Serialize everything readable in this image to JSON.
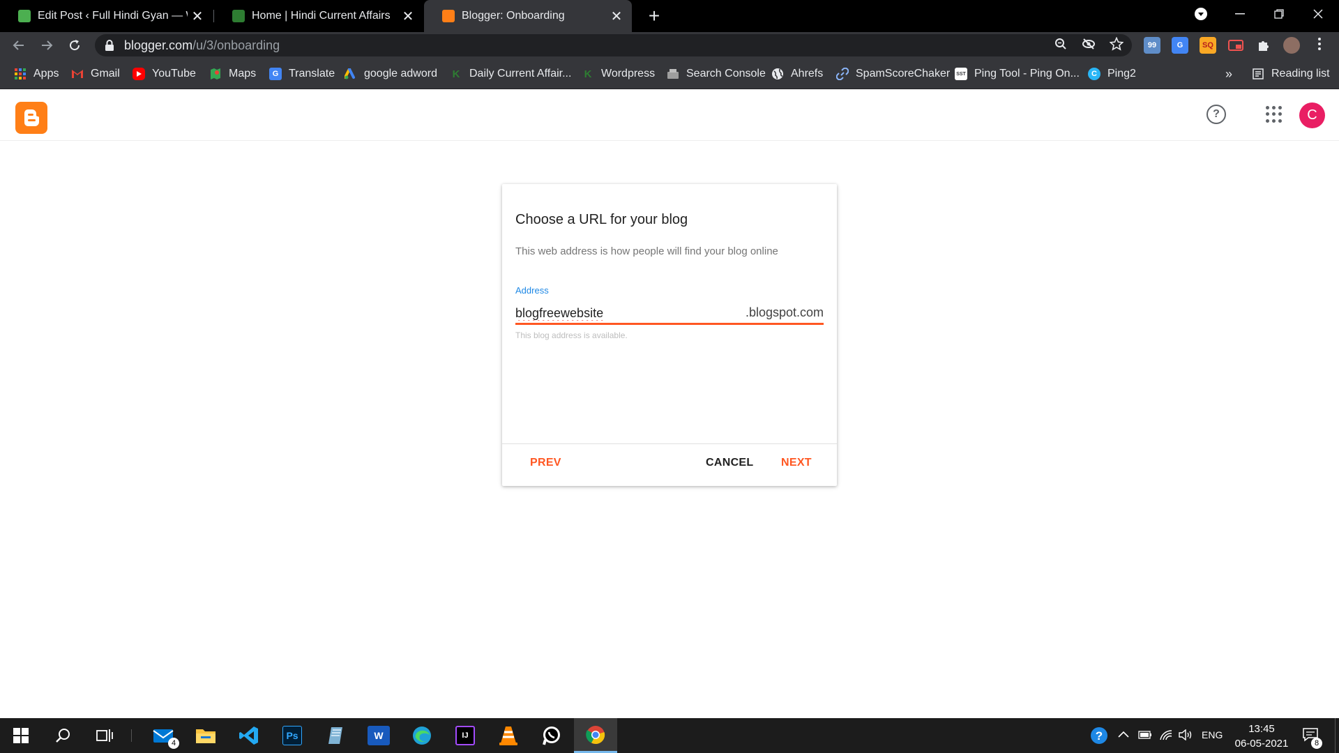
{
  "browser": {
    "tabs": [
      {
        "title": "Edit Post ‹ Full Hindi Gyan — Wo",
        "favicon": "wordpress-favicon",
        "active": false
      },
      {
        "title": "Home | Hindi Current Affairs",
        "favicon": "hindi-current-affairs-favicon",
        "active": false
      },
      {
        "title": "Blogger: Onboarding",
        "favicon": "blogger-favicon",
        "active": true
      }
    ],
    "close_glyph": "✕",
    "newtab_glyph": "+",
    "url_host": "blogger.com",
    "url_path": "/u/3/onboarding",
    "bookmarks": [
      {
        "label": "Apps",
        "icon": "apps-grid-icon",
        "color": "#4285f4"
      },
      {
        "label": "Gmail",
        "icon": "gmail-icon",
        "color": "#ea4335"
      },
      {
        "label": "YouTube",
        "icon": "youtube-icon",
        "color": "#ff0000"
      },
      {
        "label": "Maps",
        "icon": "maps-icon",
        "color": "#34a853"
      },
      {
        "label": "Translate",
        "icon": "translate-icon",
        "color": "#4285f4"
      },
      {
        "label": "google adword",
        "icon": "google-ads-icon",
        "color": "#fbbc04"
      },
      {
        "label": "Daily Current Affair...",
        "icon": "daily-current-affairs-icon",
        "color": "#2e7d32"
      },
      {
        "label": "Wordpress",
        "icon": "wordpress-bookmark-icon",
        "color": "#2e7d32"
      },
      {
        "label": "Search Console",
        "icon": "search-console-icon",
        "color": "#9e9e9e"
      },
      {
        "label": "Ahrefs",
        "icon": "globe-icon",
        "color": "#bdbdbd"
      },
      {
        "label": "SpamScoreChaker",
        "icon": "link-icon",
        "color": "#4285f4"
      },
      {
        "label": "Ping Tool - Ping On...",
        "icon": "sst-icon",
        "color": "#ffffff"
      },
      {
        "label": "Ping2",
        "icon": "ping2-icon",
        "color": "#29b6f6"
      }
    ],
    "bookmarks_overflow": "»",
    "reading_list": "Reading list"
  },
  "app": {
    "logo_icon": "blogger-logo-icon",
    "help_glyph": "?",
    "avatar_initial": "C",
    "avatar_color": "#e91e63",
    "accent_color": "#ff5722"
  },
  "dialog": {
    "title": "Choose a URL for your blog",
    "subtitle": "This web address is how people will find your blog online",
    "field_label": "Address",
    "field_value": "blogfreewebsite",
    "field_suffix": ".blogspot.com",
    "helper_text": "This blog address is available.",
    "prev_label": "PREV",
    "cancel_label": "CANCEL",
    "next_label": "NEXT"
  },
  "taskbar": {
    "apps": [
      {
        "name": "mail-app",
        "badge": "4"
      },
      {
        "name": "file-explorer-app"
      },
      {
        "name": "vscode-app"
      },
      {
        "name": "photoshop-app",
        "label": "Ps"
      },
      {
        "name": "notepad-app"
      },
      {
        "name": "word-app",
        "label": "W"
      },
      {
        "name": "edge-app"
      },
      {
        "name": "intellij-app",
        "label": "IJ"
      },
      {
        "name": "vlc-app"
      },
      {
        "name": "whatsapp-app"
      },
      {
        "name": "chrome-app",
        "active": true
      }
    ],
    "language": "ENG",
    "time": "13:45",
    "date": "06-05-2021",
    "notification_count": "8"
  }
}
